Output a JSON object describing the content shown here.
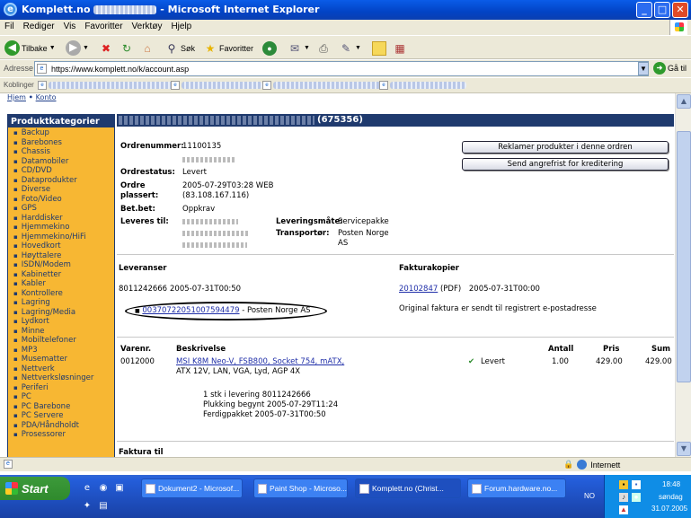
{
  "window": {
    "title_prefix": "Komplett.no",
    "title_suffix": " - Microsoft Internet Explorer",
    "controls": {
      "minimize": "_",
      "maximize": "□",
      "close": "✕"
    }
  },
  "menu": {
    "items": [
      "Fil",
      "Rediger",
      "Vis",
      "Favoritter",
      "Verktøy",
      "Hjelp"
    ]
  },
  "toolbar": {
    "back_label": "Tilbake",
    "search_label": "Søk",
    "favorites_label": "Favoritter"
  },
  "address": {
    "label": "Adresse",
    "url": "https://www.komplett.no/k/account.asp",
    "go_label": "Gå til"
  },
  "links": {
    "label": "Koblinger"
  },
  "breadcrumb": {
    "home": "Hjem",
    "sep": " • ",
    "current": "Konto"
  },
  "sidebar": {
    "header": "Produktkategorier",
    "items": [
      "Backup",
      "Barebones",
      "Chassis",
      "Datamobiler",
      "CD/DVD",
      "Dataprodukter",
      "Diverse",
      "Foto/Video",
      "GPS",
      "Harddisker",
      "Hjemmekino",
      "Hjemmekino/HiFi",
      "Hovedkort",
      "Høyttalere",
      "ISDN/Modem",
      "Kabinetter",
      "Kabler",
      "Kontrollere",
      "Lagring",
      "Lagring/Media",
      "Lydkort",
      "Minne",
      "Mobiltelefoner",
      "MP3",
      "Musematter",
      "Nettverk",
      "Nettverksløsninger",
      "Periferi",
      "PC",
      "PC Barebone",
      "PC Servere",
      "PDA/Håndholdt",
      "Prosessorer"
    ]
  },
  "order": {
    "number_suffix": "(675356)",
    "labels": {
      "ordrenummer": "Ordrenummer:",
      "ordrestatus": "Ordrestatus:",
      "plassert": "Ordre plassert:",
      "betbet": "Bet.bet:",
      "levering": "Leveres til:",
      "leveringsmate": "Leveringsmåte:",
      "transportor": "Transportør:"
    },
    "values": {
      "ordrenummer": "11100135",
      "ordrestatus": "Levert",
      "plassert_line1": "2005-07-29T03:28 WEB",
      "plassert_line2": "(83.108.167.116)",
      "betbet": "Oppkrav",
      "leveringsmate": "Servicepakke",
      "transportor_line1": "Posten Norge",
      "transportor_line2": "AS"
    },
    "buttons": {
      "reklamer": "Reklamer produkter i denne ordren",
      "send": "Send angrefrist for kreditering"
    }
  },
  "leveranser": {
    "header": "Leveranser",
    "row_id": "8011242666",
    "row_date": "2005-07-31T00:50",
    "tracking": "00370722051007594479",
    "tracking_suffix": " - Posten Norge AS"
  },
  "fakturakopier": {
    "header": "Fakturakopier",
    "invoice": "20102847",
    "invoice_type": " (PDF)",
    "invoice_date": "2005-07-31T00:00",
    "note": "Original faktura er sendt til registrert e-postadresse"
  },
  "items_table": {
    "headers": {
      "varenr": "Varenr.",
      "beskrivelse": "Beskrivelse",
      "antall": "Antall",
      "pris": "Pris",
      "sum": "Sum"
    },
    "row": {
      "varenr": "0012000",
      "desc_line1": "MSI K8M Neo-V, FSB800, Socket 754, mATX,",
      "desc_line2": "ATX 12V, LAN, VGA, Lyd, AGP 4X",
      "status": "Levert",
      "antall": "1.00",
      "pris": "429.00",
      "sum": "429.00"
    },
    "delivery_lines": [
      "1 stk i levering 8011242666",
      "Plukking begynt 2005-07-29T11:24",
      "Ferdigpakket 2005-07-31T00:50"
    ]
  },
  "faktura_til": {
    "header": "Faktura til"
  },
  "status": {
    "zone": "Internett"
  },
  "taskbar": {
    "start": "Start",
    "buttons": [
      "Dokument2 - Microsof...",
      "Paint Shop - Microso...",
      "Komplett.no (Christ...",
      "Forum.hardware.no..."
    ],
    "lang": "NO",
    "time": "18:48",
    "day": "søndag",
    "date": "31.07.2005"
  },
  "colors": {
    "navy": "#1f3a6e",
    "orange": "#f7b733",
    "link": "#1f2ea8"
  }
}
